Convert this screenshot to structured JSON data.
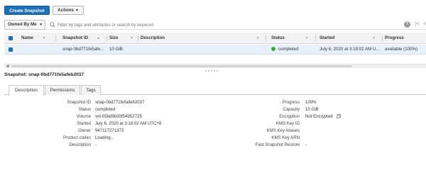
{
  "toolbar": {
    "create_label": "Create Snapshot",
    "actions_label": "Actions"
  },
  "filter": {
    "owner_label": "Owned By Me",
    "placeholder": "Filter by tags and attributes or search by keyword"
  },
  "table": {
    "headers": {
      "name": "Name",
      "snapshot_id": "Snapshot ID",
      "size": "Size",
      "description": "Description",
      "status": "Status",
      "started": "Started",
      "progress": "Progress"
    },
    "rows": [
      {
        "name": "",
        "snapshot_id": "snap-0bd771fe5afe...",
        "size": "10 GiB",
        "description": "",
        "status": "completed",
        "started": "July 6, 2020 at 3:18:02 AM U...",
        "progress": "available (100%)"
      }
    ]
  },
  "detail": {
    "title": "Snapshot: snap-0bd771fe5afeb2037",
    "tabs": [
      "Description",
      "Permissions",
      "Tags"
    ],
    "left": [
      {
        "key": "Snapshot ID",
        "value": "snap-0bd771fe5afeb2037"
      },
      {
        "key": "Status",
        "value": "completed"
      },
      {
        "key": "Volume",
        "value": "vol-05bd9b30f54952725"
      },
      {
        "key": "Started",
        "value": "July 6, 2020 at 3:18:02 AM UTC+8"
      },
      {
        "key": "Owner",
        "value": "947117271373"
      },
      {
        "key": "Product codes",
        "value": "Loading..."
      },
      {
        "key": "Description",
        "value": "-"
      }
    ],
    "right": [
      {
        "key": "Progress",
        "value": "100%"
      },
      {
        "key": "Capacity",
        "value": "10 GiB"
      },
      {
        "key": "Encryption",
        "value": "Not Encrypted"
      },
      {
        "key": "KMS Key ID",
        "value": ""
      },
      {
        "key": "KMS Key Aliases",
        "value": ""
      },
      {
        "key": "KMS Key ARN",
        "value": ""
      },
      {
        "key": "Fast Snapshot Restore",
        "value": "-"
      }
    ]
  },
  "colors": {
    "primary": "#1f6fb8",
    "selected_row": "#e8f1fb",
    "status_ok": "#33b02a"
  }
}
